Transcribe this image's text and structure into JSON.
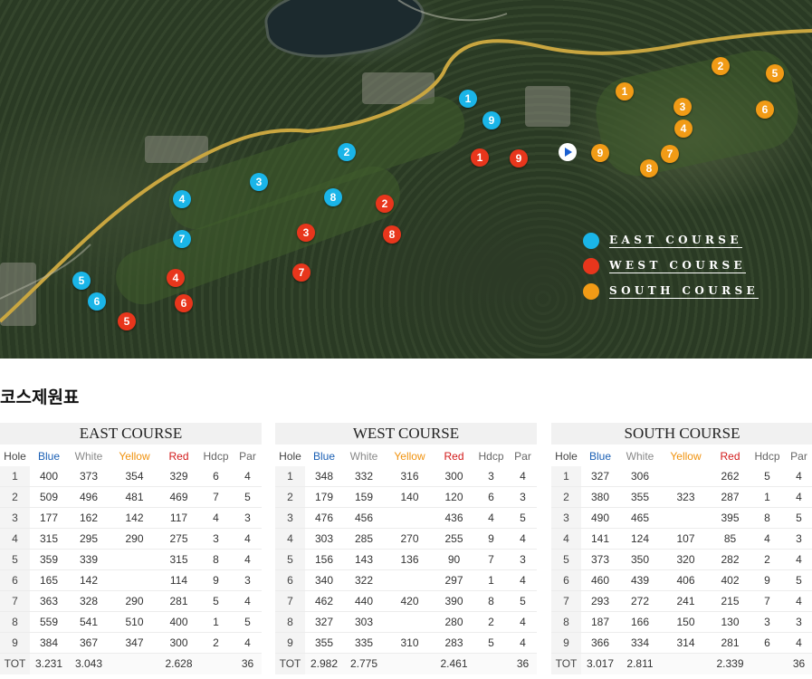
{
  "map": {
    "clubhouse_icon": "clubhouse-play-icon",
    "markers": {
      "east": [
        "1",
        "2",
        "3",
        "4",
        "5",
        "6",
        "7",
        "8",
        "9"
      ],
      "west": [
        "1",
        "2",
        "3",
        "4",
        "5",
        "6",
        "7",
        "8",
        "9"
      ],
      "south": [
        "1",
        "2",
        "3",
        "4",
        "5",
        "6",
        "7",
        "8",
        "9"
      ]
    },
    "legend": [
      {
        "label": "EAST COURSE",
        "color": "#1ab5e8"
      },
      {
        "label": "WEST COURSE",
        "color": "#e8361c"
      },
      {
        "label": "SOUTH COURSE",
        "color": "#f19b16"
      }
    ],
    "colors": {
      "east": "#1ab5e8",
      "west": "#e8361c",
      "south": "#f19b16",
      "road": "#c9a640"
    }
  },
  "section_title": "코스제원표",
  "header": [
    "Hole",
    "Blue",
    "White",
    "Yellow",
    "Red",
    "Hdcp",
    "Par"
  ],
  "courses": [
    {
      "title": "EAST COURSE",
      "rows": [
        [
          "1",
          "400",
          "373",
          "354",
          "329",
          "6",
          "4"
        ],
        [
          "2",
          "509",
          "496",
          "481",
          "469",
          "7",
          "5"
        ],
        [
          "3",
          "177",
          "162",
          "142",
          "117",
          "4",
          "3"
        ],
        [
          "4",
          "315",
          "295",
          "290",
          "275",
          "3",
          "4"
        ],
        [
          "5",
          "359",
          "339",
          "",
          "315",
          "8",
          "4"
        ],
        [
          "6",
          "165",
          "142",
          "",
          "114",
          "9",
          "3"
        ],
        [
          "7",
          "363",
          "328",
          "290",
          "281",
          "5",
          "4"
        ],
        [
          "8",
          "559",
          "541",
          "510",
          "400",
          "1",
          "5"
        ],
        [
          "9",
          "384",
          "367",
          "347",
          "300",
          "2",
          "4"
        ]
      ],
      "total": [
        "TOT",
        "3.231",
        "3.043",
        "",
        "2.628",
        "",
        "36"
      ]
    },
    {
      "title": "WEST COURSE",
      "rows": [
        [
          "1",
          "348",
          "332",
          "316",
          "300",
          "3",
          "4"
        ],
        [
          "2",
          "179",
          "159",
          "140",
          "120",
          "6",
          "3"
        ],
        [
          "3",
          "476",
          "456",
          "",
          "436",
          "4",
          "5"
        ],
        [
          "4",
          "303",
          "285",
          "270",
          "255",
          "9",
          "4"
        ],
        [
          "5",
          "156",
          "143",
          "136",
          "90",
          "7",
          "3"
        ],
        [
          "6",
          "340",
          "322",
          "",
          "297",
          "1",
          "4"
        ],
        [
          "7",
          "462",
          "440",
          "420",
          "390",
          "8",
          "5"
        ],
        [
          "8",
          "327",
          "303",
          "",
          "280",
          "2",
          "4"
        ],
        [
          "9",
          "355",
          "335",
          "310",
          "283",
          "5",
          "4"
        ]
      ],
      "total": [
        "TOT",
        "2.982",
        "2.775",
        "",
        "2.461",
        "",
        "36"
      ]
    },
    {
      "title": "SOUTH COURSE",
      "rows": [
        [
          "1",
          "327",
          "306",
          "",
          "262",
          "5",
          "4"
        ],
        [
          "2",
          "380",
          "355",
          "323",
          "287",
          "1",
          "4"
        ],
        [
          "3",
          "490",
          "465",
          "",
          "395",
          "8",
          "5"
        ],
        [
          "4",
          "141",
          "124",
          "107",
          "85",
          "4",
          "3"
        ],
        [
          "5",
          "373",
          "350",
          "320",
          "282",
          "2",
          "4"
        ],
        [
          "6",
          "460",
          "439",
          "406",
          "402",
          "9",
          "5"
        ],
        [
          "7",
          "293",
          "272",
          "241",
          "215",
          "7",
          "4"
        ],
        [
          "8",
          "187",
          "166",
          "150",
          "130",
          "3",
          "3"
        ],
        [
          "9",
          "366",
          "334",
          "314",
          "281",
          "6",
          "4"
        ]
      ],
      "total": [
        "TOT",
        "3.017",
        "2.811",
        "",
        "2.339",
        "",
        "36"
      ]
    }
  ]
}
